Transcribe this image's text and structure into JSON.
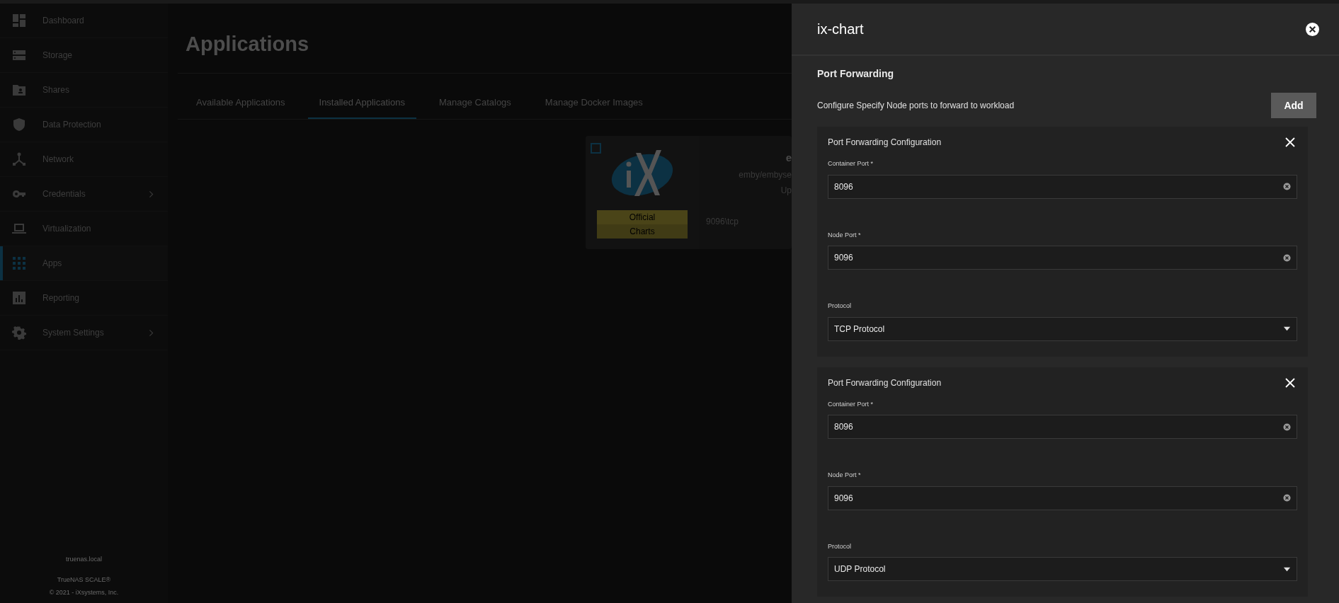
{
  "sidebar": {
    "items": [
      {
        "label": "Dashboard",
        "selected": false,
        "expandable": false
      },
      {
        "label": "Storage",
        "selected": false,
        "expandable": false
      },
      {
        "label": "Shares",
        "selected": false,
        "expandable": false
      },
      {
        "label": "Data Protection",
        "selected": false,
        "expandable": false
      },
      {
        "label": "Network",
        "selected": false,
        "expandable": false
      },
      {
        "label": "Credentials",
        "selected": false,
        "expandable": true
      },
      {
        "label": "Virtualization",
        "selected": false,
        "expandable": false
      },
      {
        "label": "Apps",
        "selected": true,
        "expandable": false
      },
      {
        "label": "Reporting",
        "selected": false,
        "expandable": false
      },
      {
        "label": "System Settings",
        "selected": false,
        "expandable": true
      }
    ],
    "hostname": "truenas.local",
    "product": "TrueNAS SCALE®",
    "copyright": "© 2021 - iXsystems, Inc."
  },
  "page": {
    "title": "Applications",
    "tabs": [
      {
        "label": "Available Applications",
        "selected": false
      },
      {
        "label": "Installed Applications",
        "selected": true
      },
      {
        "label": "Manage Catalogs",
        "selected": false
      },
      {
        "label": "Manage Docker Images",
        "selected": false
      }
    ],
    "app_card": {
      "checked": false,
      "badges": [
        "Official",
        "Charts"
      ],
      "name": "e",
      "image": "emby/embyse",
      "status": "Up",
      "ports": "9096\\tcp"
    }
  },
  "panel": {
    "title": "ix-chart",
    "section": "Port Forwarding",
    "description": "Configure Specify Node ports to forward to workload",
    "add_button": "Add",
    "configs": [
      {
        "title": "Port Forwarding Configuration",
        "fields": [
          {
            "kind": "text",
            "label": "Container Port *",
            "value": "8096"
          },
          {
            "kind": "text",
            "label": "Node Port *",
            "value": "9096"
          },
          {
            "kind": "select",
            "label": "Protocol",
            "value": "TCP Protocol"
          }
        ]
      },
      {
        "title": "Port Forwarding Configuration",
        "fields": [
          {
            "kind": "text",
            "label": "Container Port *",
            "value": "8096"
          },
          {
            "kind": "text",
            "label": "Node Port *",
            "value": "9096"
          },
          {
            "kind": "select",
            "label": "Protocol",
            "value": "UDP Protocol"
          }
        ]
      }
    ]
  }
}
